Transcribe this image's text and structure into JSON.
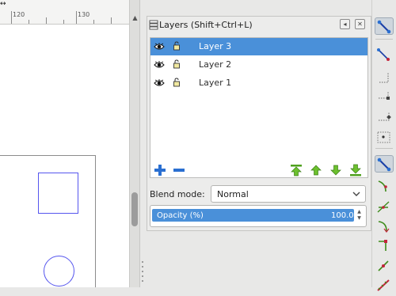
{
  "canvas": {
    "ruler_labels": [
      "120",
      "130"
    ],
    "corner_marker": "↔"
  },
  "layers_panel": {
    "title": "Layers (Shift+Ctrl+L)",
    "title_buttons": [
      "◂",
      "✕"
    ],
    "layers": [
      {
        "name": "Layer 3",
        "selected": true,
        "visible": true,
        "locked": false
      },
      {
        "name": "Layer 2",
        "selected": false,
        "visible": true,
        "locked": false
      },
      {
        "name": "Layer 1",
        "selected": false,
        "visible": true,
        "locked": false
      }
    ],
    "actions": [
      "add-layer-icon",
      "remove-layer-icon",
      "raise-to-top-icon",
      "raise-layer-icon",
      "lower-layer-icon",
      "lower-to-bottom-icon"
    ],
    "blend_mode_label": "Blend mode:",
    "blend_mode_value": "Normal",
    "opacity_label": "Opacity (%)",
    "opacity_value": "100.0",
    "opacity_fraction": 1.0
  },
  "snap_toolbar": {
    "buttons": [
      {
        "icon": "snap-enable-icon",
        "active": true
      },
      {
        "icon": "snap-bbox-icon",
        "active": false
      },
      {
        "icon": "snap-bbox-edges-icon",
        "active": false
      },
      {
        "icon": "snap-bbox-corners-icon",
        "active": false
      },
      {
        "icon": "snap-bbox-midpoints-icon",
        "active": false
      },
      {
        "icon": "snap-bbox-center-icon",
        "active": false
      },
      {
        "icon": "snap-nodes-icon",
        "active": true
      },
      {
        "icon": "snap-paths-icon",
        "active": false
      },
      {
        "icon": "snap-intersections-icon",
        "active": false
      },
      {
        "icon": "snap-cusp-nodes-icon",
        "active": false
      },
      {
        "icon": "snap-smooth-nodes-icon",
        "active": false
      },
      {
        "icon": "snap-midpoints-icon",
        "active": false
      },
      {
        "icon": "snap-path-midpoints-icon",
        "active": false
      }
    ]
  },
  "colors": {
    "selection": "#4a90d9",
    "action_green": "#4fa11e",
    "action_blue": "#2a6fd1",
    "shape_stroke": "#5555ee"
  }
}
